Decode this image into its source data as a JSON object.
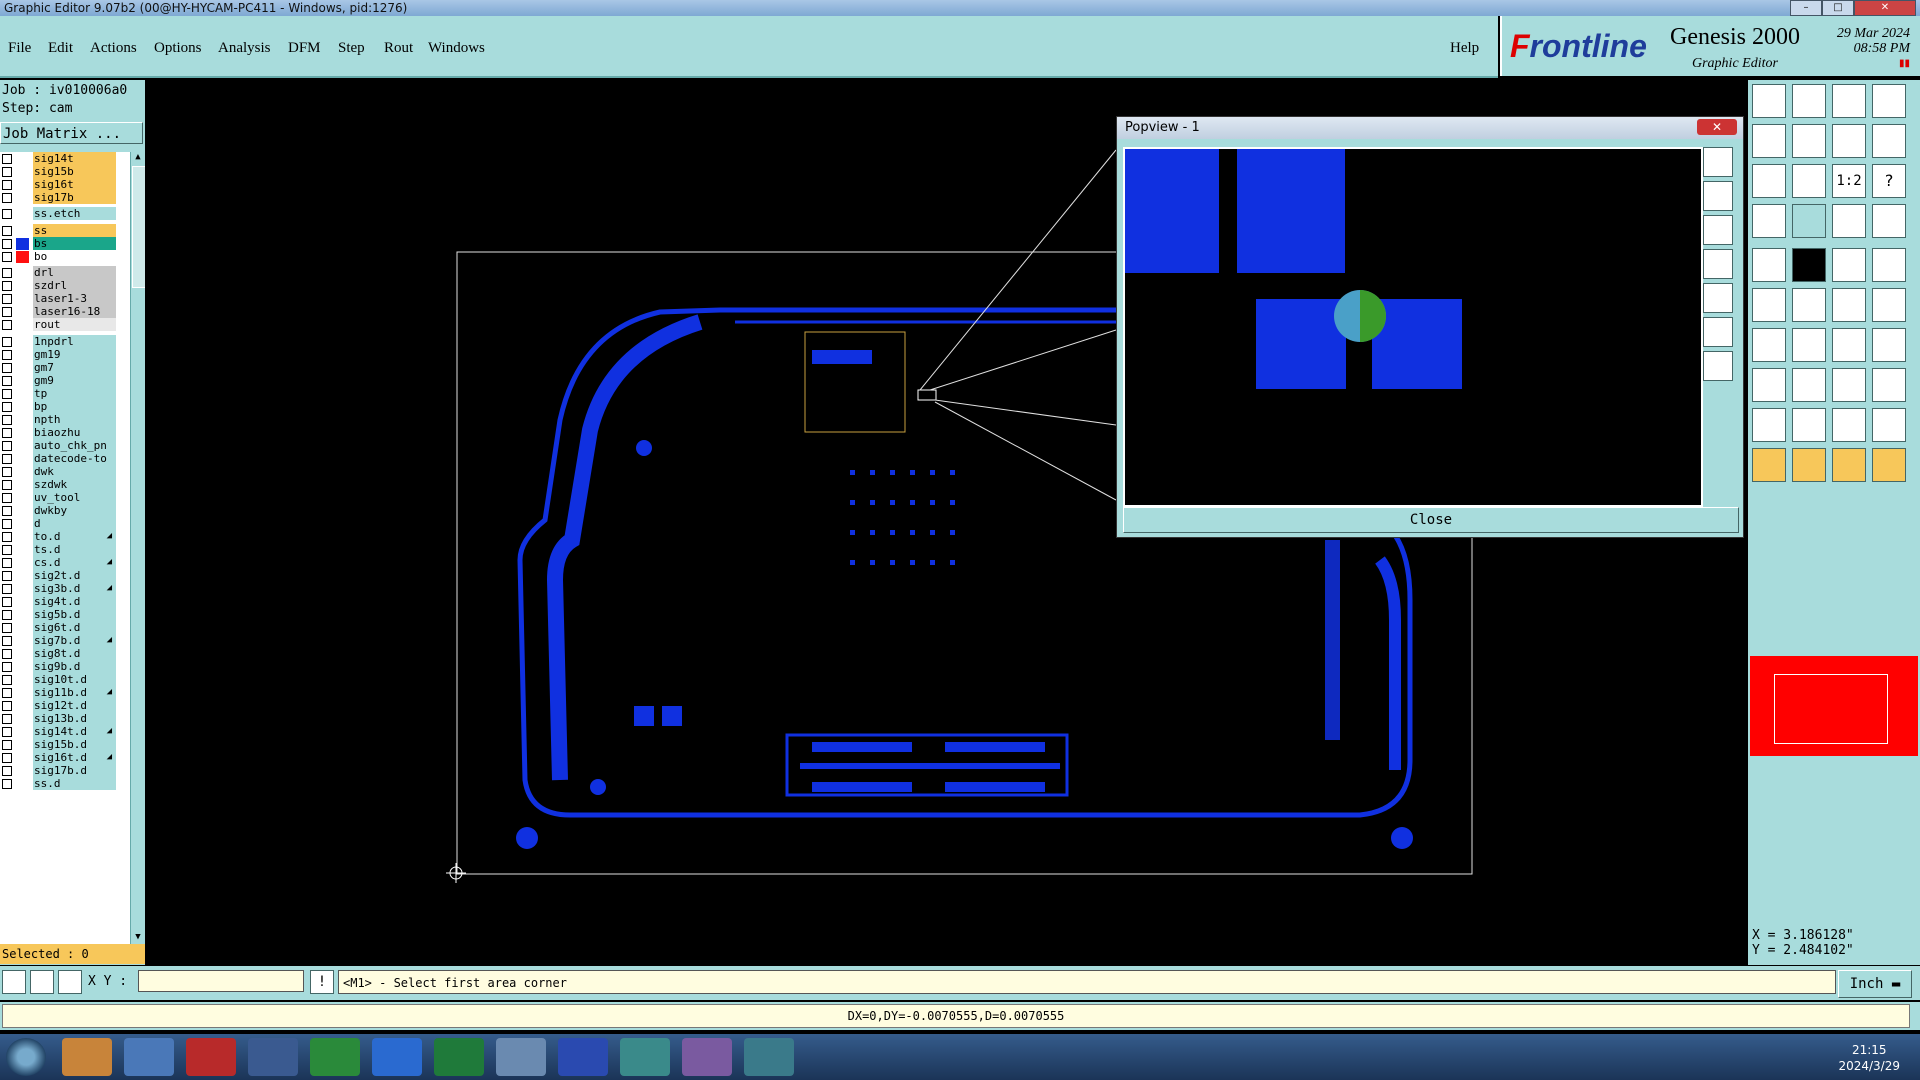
{
  "window": {
    "title": "Graphic Editor 9.07b2 (00@HY-HYCAM-PC411 - Windows, pid:1276)"
  },
  "menu": {
    "items": [
      "File",
      "Edit",
      "Actions",
      "Options",
      "Analysis",
      "DFM",
      "Step",
      "Rout",
      "Windows"
    ],
    "help": "Help"
  },
  "brand": {
    "logo_accent": "F",
    "logo_rest": "rontline",
    "product": "Genesis 2000",
    "subtitle": "Graphic Editor",
    "date": "29 Mar 2024",
    "time": "08:58 PM"
  },
  "job": {
    "job_line": "Job : iv010006a0",
    "step_line": "Step: cam",
    "matrix_button": "Job Matrix ..."
  },
  "layers": [
    {
      "name": "sig14t",
      "color": "#f7c75a",
      "swatch": "",
      "mark": ""
    },
    {
      "name": "sig15b",
      "color": "#f7c75a",
      "swatch": "",
      "mark": ""
    },
    {
      "name": "sig16t",
      "color": "#f7c75a",
      "swatch": "",
      "mark": ""
    },
    {
      "name": "sig17b",
      "color": "#f7c75a",
      "swatch": "",
      "mark": ""
    },
    {
      "name": "ss.etch",
      "color": "#a8dcdc",
      "swatch": "",
      "mark": ""
    },
    {
      "name": "ss",
      "color": "#f7c75a",
      "swatch": "",
      "mark": ""
    },
    {
      "name": "bs",
      "color": "#1aa68a",
      "swatch": "#1030e0",
      "mark": ""
    },
    {
      "name": "bo",
      "color": "#ffffff",
      "swatch": "#ff1010",
      "mark": ""
    },
    {
      "name": "drl",
      "color": "#c8c8c8",
      "swatch": "",
      "mark": ""
    },
    {
      "name": "szdrl",
      "color": "#c8c8c8",
      "swatch": "",
      "mark": ""
    },
    {
      "name": "laser1-3",
      "color": "#c8c8c8",
      "swatch": "",
      "mark": ""
    },
    {
      "name": "laser16-18",
      "color": "#c8c8c8",
      "swatch": "",
      "mark": ""
    },
    {
      "name": "rout",
      "color": "#e8e8e8",
      "swatch": "",
      "mark": ""
    },
    {
      "name": "1npdrl",
      "color": "#a8dcdc",
      "swatch": "",
      "mark": ""
    },
    {
      "name": "gm19",
      "color": "#a8dcdc",
      "swatch": "",
      "mark": ""
    },
    {
      "name": "gm7",
      "color": "#a8dcdc",
      "swatch": "",
      "mark": ""
    },
    {
      "name": "gm9",
      "color": "#a8dcdc",
      "swatch": "",
      "mark": ""
    },
    {
      "name": "tp",
      "color": "#a8dcdc",
      "swatch": "",
      "mark": ""
    },
    {
      "name": "bp",
      "color": "#a8dcdc",
      "swatch": "",
      "mark": ""
    },
    {
      "name": "npth",
      "color": "#a8dcdc",
      "swatch": "",
      "mark": ""
    },
    {
      "name": "biaozhu",
      "color": "#a8dcdc",
      "swatch": "",
      "mark": ""
    },
    {
      "name": "auto_chk_pn",
      "color": "#a8dcdc",
      "swatch": "",
      "mark": ""
    },
    {
      "name": "datecode-to",
      "color": "#a8dcdc",
      "swatch": "",
      "mark": ""
    },
    {
      "name": "dwk",
      "color": "#a8dcdc",
      "swatch": "",
      "mark": ""
    },
    {
      "name": "szdwk",
      "color": "#a8dcdc",
      "swatch": "",
      "mark": ""
    },
    {
      "name": "uv_tool",
      "color": "#a8dcdc",
      "swatch": "",
      "mark": ""
    },
    {
      "name": "dwkby",
      "color": "#a8dcdc",
      "swatch": "",
      "mark": ""
    },
    {
      "name": "d",
      "color": "#a8dcdc",
      "swatch": "",
      "mark": ""
    },
    {
      "name": "to.d",
      "color": "#a8dcdc",
      "swatch": "",
      "mark": "◢"
    },
    {
      "name": "ts.d",
      "color": "#a8dcdc",
      "swatch": "",
      "mark": ""
    },
    {
      "name": "cs.d",
      "color": "#a8dcdc",
      "swatch": "",
      "mark": "◢"
    },
    {
      "name": "sig2t.d",
      "color": "#a8dcdc",
      "swatch": "",
      "mark": ""
    },
    {
      "name": "sig3b.d",
      "color": "#a8dcdc",
      "swatch": "",
      "mark": "◢"
    },
    {
      "name": "sig4t.d",
      "color": "#a8dcdc",
      "swatch": "",
      "mark": ""
    },
    {
      "name": "sig5b.d",
      "color": "#a8dcdc",
      "swatch": "",
      "mark": ""
    },
    {
      "name": "sig6t.d",
      "color": "#a8dcdc",
      "swatch": "",
      "mark": ""
    },
    {
      "name": "sig7b.d",
      "color": "#a8dcdc",
      "swatch": "",
      "mark": "◢"
    },
    {
      "name": "sig8t.d",
      "color": "#a8dcdc",
      "swatch": "",
      "mark": ""
    },
    {
      "name": "sig9b.d",
      "color": "#a8dcdc",
      "swatch": "",
      "mark": ""
    },
    {
      "name": "sig10t.d",
      "color": "#a8dcdc",
      "swatch": "",
      "mark": ""
    },
    {
      "name": "sig11b.d",
      "color": "#a8dcdc",
      "swatch": "",
      "mark": "◢"
    },
    {
      "name": "sig12t.d",
      "color": "#a8dcdc",
      "swatch": "",
      "mark": ""
    },
    {
      "name": "sig13b.d",
      "color": "#a8dcdc",
      "swatch": "",
      "mark": ""
    },
    {
      "name": "sig14t.d",
      "color": "#a8dcdc",
      "swatch": "",
      "mark": "◢"
    },
    {
      "name": "sig15b.d",
      "color": "#a8dcdc",
      "swatch": "",
      "mark": ""
    },
    {
      "name": "sig16t.d",
      "color": "#a8dcdc",
      "swatch": "",
      "mark": "◢"
    },
    {
      "name": "sig17b.d",
      "color": "#a8dcdc",
      "swatch": "",
      "mark": ""
    },
    {
      "name": "ss.d",
      "color": "#a8dcdc",
      "swatch": "",
      "mark": ""
    }
  ],
  "selected": "Selected : 0",
  "popview": {
    "title": "Popview - 1",
    "close_x": "✕",
    "close_button": "Close"
  },
  "coords": {
    "x": "X = 3.186128\"",
    "y": "Y = 2.484102\""
  },
  "command": {
    "xy_label": "X Y :",
    "xy_value": "",
    "prompt": "<M1> - Select first area corner",
    "units": "Inch ▬"
  },
  "status": "DX=0,DY=-0.0070555,D=0.0070555",
  "clock": {
    "time": "21:15",
    "date": "2024/3/29"
  },
  "colors": {
    "pcb_blue": "#1030e0",
    "panel": "#a8dcdc",
    "highlight": "#f7c75a"
  }
}
